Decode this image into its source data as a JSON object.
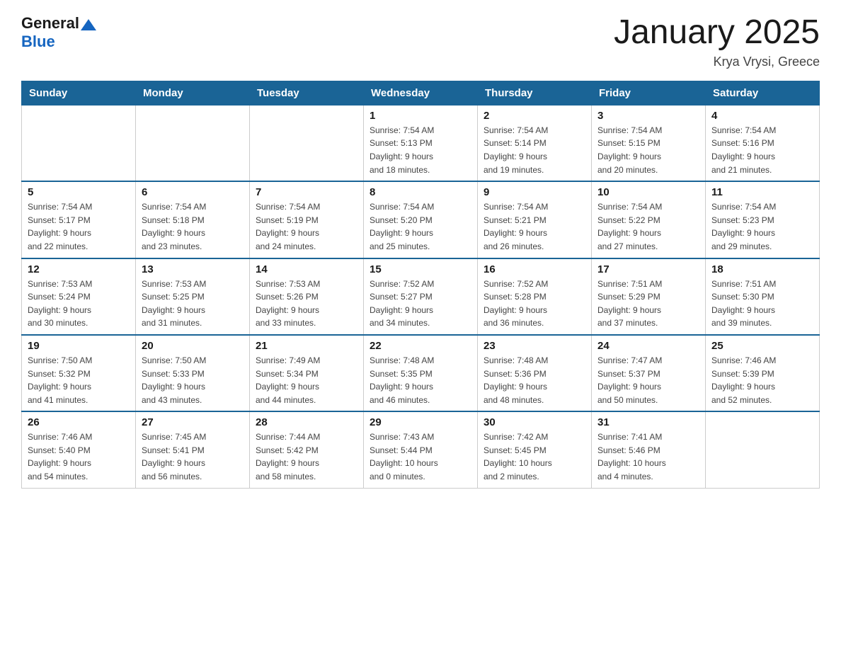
{
  "header": {
    "logo_general": "General",
    "logo_blue": "Blue",
    "title": "January 2025",
    "subtitle": "Krya Vrysi, Greece"
  },
  "days_of_week": [
    "Sunday",
    "Monday",
    "Tuesday",
    "Wednesday",
    "Thursday",
    "Friday",
    "Saturday"
  ],
  "weeks": [
    [
      {
        "day": "",
        "info": ""
      },
      {
        "day": "",
        "info": ""
      },
      {
        "day": "",
        "info": ""
      },
      {
        "day": "1",
        "info": "Sunrise: 7:54 AM\nSunset: 5:13 PM\nDaylight: 9 hours\nand 18 minutes."
      },
      {
        "day": "2",
        "info": "Sunrise: 7:54 AM\nSunset: 5:14 PM\nDaylight: 9 hours\nand 19 minutes."
      },
      {
        "day": "3",
        "info": "Sunrise: 7:54 AM\nSunset: 5:15 PM\nDaylight: 9 hours\nand 20 minutes."
      },
      {
        "day": "4",
        "info": "Sunrise: 7:54 AM\nSunset: 5:16 PM\nDaylight: 9 hours\nand 21 minutes."
      }
    ],
    [
      {
        "day": "5",
        "info": "Sunrise: 7:54 AM\nSunset: 5:17 PM\nDaylight: 9 hours\nand 22 minutes."
      },
      {
        "day": "6",
        "info": "Sunrise: 7:54 AM\nSunset: 5:18 PM\nDaylight: 9 hours\nand 23 minutes."
      },
      {
        "day": "7",
        "info": "Sunrise: 7:54 AM\nSunset: 5:19 PM\nDaylight: 9 hours\nand 24 minutes."
      },
      {
        "day": "8",
        "info": "Sunrise: 7:54 AM\nSunset: 5:20 PM\nDaylight: 9 hours\nand 25 minutes."
      },
      {
        "day": "9",
        "info": "Sunrise: 7:54 AM\nSunset: 5:21 PM\nDaylight: 9 hours\nand 26 minutes."
      },
      {
        "day": "10",
        "info": "Sunrise: 7:54 AM\nSunset: 5:22 PM\nDaylight: 9 hours\nand 27 minutes."
      },
      {
        "day": "11",
        "info": "Sunrise: 7:54 AM\nSunset: 5:23 PM\nDaylight: 9 hours\nand 29 minutes."
      }
    ],
    [
      {
        "day": "12",
        "info": "Sunrise: 7:53 AM\nSunset: 5:24 PM\nDaylight: 9 hours\nand 30 minutes."
      },
      {
        "day": "13",
        "info": "Sunrise: 7:53 AM\nSunset: 5:25 PM\nDaylight: 9 hours\nand 31 minutes."
      },
      {
        "day": "14",
        "info": "Sunrise: 7:53 AM\nSunset: 5:26 PM\nDaylight: 9 hours\nand 33 minutes."
      },
      {
        "day": "15",
        "info": "Sunrise: 7:52 AM\nSunset: 5:27 PM\nDaylight: 9 hours\nand 34 minutes."
      },
      {
        "day": "16",
        "info": "Sunrise: 7:52 AM\nSunset: 5:28 PM\nDaylight: 9 hours\nand 36 minutes."
      },
      {
        "day": "17",
        "info": "Sunrise: 7:51 AM\nSunset: 5:29 PM\nDaylight: 9 hours\nand 37 minutes."
      },
      {
        "day": "18",
        "info": "Sunrise: 7:51 AM\nSunset: 5:30 PM\nDaylight: 9 hours\nand 39 minutes."
      }
    ],
    [
      {
        "day": "19",
        "info": "Sunrise: 7:50 AM\nSunset: 5:32 PM\nDaylight: 9 hours\nand 41 minutes."
      },
      {
        "day": "20",
        "info": "Sunrise: 7:50 AM\nSunset: 5:33 PM\nDaylight: 9 hours\nand 43 minutes."
      },
      {
        "day": "21",
        "info": "Sunrise: 7:49 AM\nSunset: 5:34 PM\nDaylight: 9 hours\nand 44 minutes."
      },
      {
        "day": "22",
        "info": "Sunrise: 7:48 AM\nSunset: 5:35 PM\nDaylight: 9 hours\nand 46 minutes."
      },
      {
        "day": "23",
        "info": "Sunrise: 7:48 AM\nSunset: 5:36 PM\nDaylight: 9 hours\nand 48 minutes."
      },
      {
        "day": "24",
        "info": "Sunrise: 7:47 AM\nSunset: 5:37 PM\nDaylight: 9 hours\nand 50 minutes."
      },
      {
        "day": "25",
        "info": "Sunrise: 7:46 AM\nSunset: 5:39 PM\nDaylight: 9 hours\nand 52 minutes."
      }
    ],
    [
      {
        "day": "26",
        "info": "Sunrise: 7:46 AM\nSunset: 5:40 PM\nDaylight: 9 hours\nand 54 minutes."
      },
      {
        "day": "27",
        "info": "Sunrise: 7:45 AM\nSunset: 5:41 PM\nDaylight: 9 hours\nand 56 minutes."
      },
      {
        "day": "28",
        "info": "Sunrise: 7:44 AM\nSunset: 5:42 PM\nDaylight: 9 hours\nand 58 minutes."
      },
      {
        "day": "29",
        "info": "Sunrise: 7:43 AM\nSunset: 5:44 PM\nDaylight: 10 hours\nand 0 minutes."
      },
      {
        "day": "30",
        "info": "Sunrise: 7:42 AM\nSunset: 5:45 PM\nDaylight: 10 hours\nand 2 minutes."
      },
      {
        "day": "31",
        "info": "Sunrise: 7:41 AM\nSunset: 5:46 PM\nDaylight: 10 hours\nand 4 minutes."
      },
      {
        "day": "",
        "info": ""
      }
    ]
  ]
}
